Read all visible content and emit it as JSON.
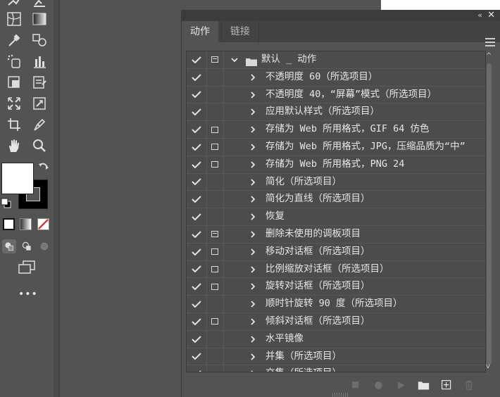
{
  "panel": {
    "tabs": [
      {
        "label": "动作",
        "active": true
      },
      {
        "label": "链接",
        "active": false
      }
    ],
    "collapse_glyph": "«",
    "close_glyph": "✕"
  },
  "actions_set": {
    "name": "默认 _ 动作",
    "enabled": true,
    "expanded": true,
    "dialog_state": "partial"
  },
  "actions": [
    {
      "label": "不透明度 60（所选项目）",
      "enabled": true,
      "dialog": false
    },
    {
      "label": "不透明度 40，“屏幕”模式（所选项目）",
      "enabled": true,
      "dialog": false
    },
    {
      "label": "应用默认样式（所选项目）",
      "enabled": true,
      "dialog": false
    },
    {
      "label": "存储为 Web 所用格式，GIF 64 仿色",
      "enabled": true,
      "dialog": true
    },
    {
      "label": "存储为 Web 所用格式，JPG，压缩品质为“中”",
      "enabled": true,
      "dialog": true
    },
    {
      "label": "存储为 Web 所用格式，PNG 24",
      "enabled": true,
      "dialog": true
    },
    {
      "label": "简化（所选项目）",
      "enabled": true,
      "dialog": false
    },
    {
      "label": "简化为直线（所选项目）",
      "enabled": true,
      "dialog": false
    },
    {
      "label": "恢复",
      "enabled": true,
      "dialog": false
    },
    {
      "label": "删除未使用的调板项目",
      "enabled": true,
      "dialog": "set"
    },
    {
      "label": "移动对话框（所选项目）",
      "enabled": true,
      "dialog": true
    },
    {
      "label": "比例缩放对话框（所选项目）",
      "enabled": true,
      "dialog": true
    },
    {
      "label": "旋转对话框（所选项目）",
      "enabled": true,
      "dialog": true
    },
    {
      "label": "顺时针旋转 90 度（所选项目）",
      "enabled": true,
      "dialog": false
    },
    {
      "label": "倾斜对话框（所选项目）",
      "enabled": true,
      "dialog": true
    },
    {
      "label": "水平镜像",
      "enabled": true,
      "dialog": false
    },
    {
      "label": "并集（所选项目）",
      "enabled": true,
      "dialog": false
    },
    {
      "label": "交集（所选项目）",
      "enabled": true,
      "dialog": false
    }
  ],
  "bottom_icons": [
    "stop-icon",
    "record-icon",
    "play-icon",
    "new-set-folder-icon",
    "new-action-icon",
    "delete-icon"
  ],
  "toolbar": {
    "more_label": "•••",
    "fill_color": "#ffffff",
    "stroke_color": "#000000"
  },
  "colors": {
    "panel_bg": "#535353",
    "list_bg": "#4c4c4c",
    "text": "#e6e6e6"
  }
}
